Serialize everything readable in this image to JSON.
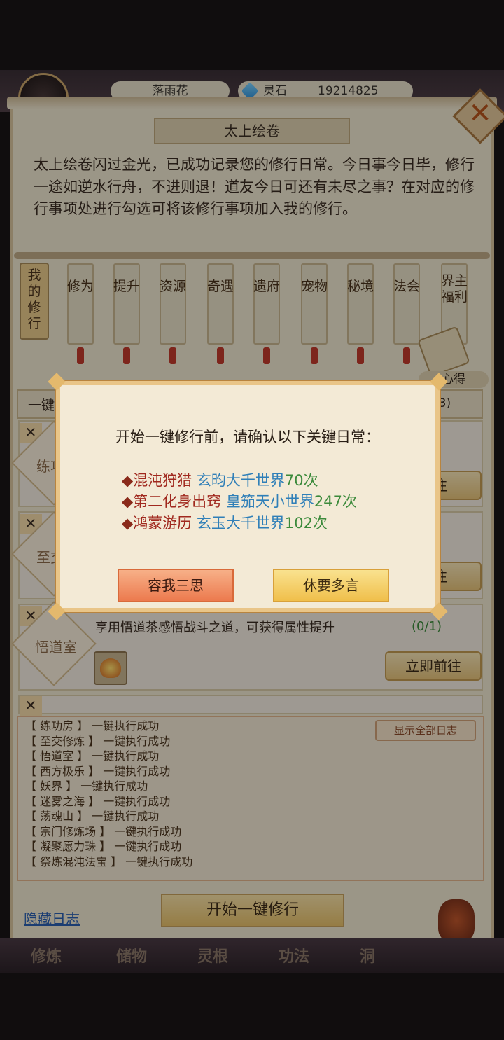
{
  "header": {
    "player_name": "落雨花",
    "stone_label": "灵石",
    "stone_value": "19214825"
  },
  "scroll": {
    "title": "太上绘卷",
    "close_icon": "close-x-icon",
    "intro": "太上绘卷闪过金光，已成功记录您的修行日常。今日事今日毕，修行一途如逆水行舟，不进则退！道友今日可还有未尽之事？在对应的修行事项处进行勾选可将该修行事项加入我的修行。",
    "my_tab": "我的修行",
    "tabs": [
      "修为",
      "提升",
      "资源",
      "奇遇",
      "遗府",
      "宠物",
      "秘境",
      "法会",
      "界主福利"
    ],
    "heart_label": "心得"
  },
  "tasks": {
    "onekey_label": "一键",
    "count_label": "(3)",
    "row1": {
      "name": "练功",
      "go": "前往"
    },
    "row2": {
      "name": "至交修",
      "go": "前往"
    },
    "row3": {
      "name": "悟道室",
      "desc": "享用悟道茶感悟战斗之道，可获得属性提升",
      "progress": "(0/1)",
      "go": "立即前往"
    }
  },
  "log": {
    "show_all": "显示全部日志",
    "items": [
      "【 练功房 】 一键执行成功",
      "【 至交修炼 】 一键执行成功",
      "【 悟道室 】 一键执行成功",
      "【 西方极乐 】 一键执行成功",
      "【 妖界 】 一键执行成功",
      "【 迷雾之海 】 一键执行成功",
      "【 荡魂山 】 一键执行成功",
      "【 宗门修炼场 】 一键执行成功",
      "【 凝聚愿力珠 】 一键执行成功",
      "【 祭炼混沌法宝 】 一键执行成功"
    ]
  },
  "footer": {
    "hide_log": "隐藏日志",
    "start": "开始一键修行",
    "nav": [
      "修炼",
      "储物",
      "灵根",
      "功法",
      "洞"
    ]
  },
  "modal": {
    "title": "开始一键修行前，请确认以下关键日常：",
    "diamond": "◆",
    "entries": [
      {
        "activity": "混沌狩猎",
        "world": "玄昀大千世界",
        "count": "70次"
      },
      {
        "activity": "第二化身出窍",
        "world": "皇笳天小世界",
        "count": "247次"
      },
      {
        "activity": "鸿蒙游历",
        "world": "玄玉大千世界",
        "count": "102次"
      }
    ],
    "cancel": "容我三思",
    "confirm": "休要多言"
  },
  "colors": {
    "activity": "#a0281e",
    "world": "#2f7fb8",
    "count": "#3b8a3b"
  }
}
